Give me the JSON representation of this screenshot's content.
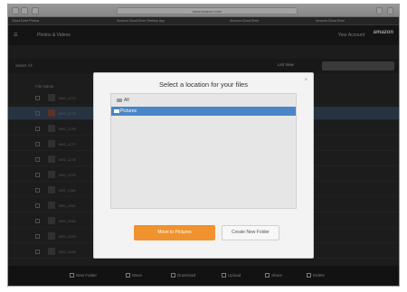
{
  "browser": {
    "url": "www.amazon.com",
    "bookmarks": [
      "Cloud Drive Photos",
      "Amazon Cloud Drive Desktop App",
      "Amazon Cloud Drive",
      "Amazon Cloud Drive"
    ]
  },
  "app": {
    "menu_label": "☰",
    "breadcrumb": "Photos & Videos",
    "account": "Your Account",
    "brand": "amazon"
  },
  "toolbar": {
    "select_all": "Select All",
    "view_label": "List View"
  },
  "list": {
    "header": "File Name",
    "rows": [
      "IMG_1274",
      "IMG_1275",
      "IMG_1276",
      "IMG_1277",
      "IMG_1278",
      "IMG_1279",
      "IMG_1280",
      "IMG_1281",
      "IMG_1282",
      "IMG_1283",
      "IMG_1284"
    ]
  },
  "bottom_actions": [
    "New Folder",
    "Move",
    "Download",
    "Upload",
    "Share",
    "Delete"
  ],
  "dialog": {
    "title": "Select a location for your files",
    "root_item": "All",
    "selected_item": "Pictures",
    "move_button": "Move to Pictures",
    "create_button": "Create New Folder",
    "close_label": "×"
  }
}
